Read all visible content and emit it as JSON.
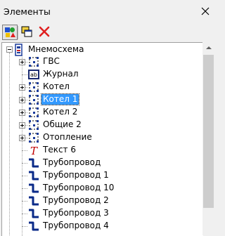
{
  "window": {
    "title": "Элементы"
  },
  "toolbar": {
    "buttons": [
      {
        "name": "elements-view-button",
        "icon": "colored-shapes-icon",
        "pressed": true
      },
      {
        "name": "layers-button",
        "icon": "stacked-windows-icon",
        "pressed": false
      },
      {
        "name": "delete-button",
        "icon": "red-x-icon",
        "pressed": false
      }
    ]
  },
  "tree": {
    "root": {
      "label": "Мнемосхема",
      "icon": "mnemoscheme-icon",
      "expanded": true
    },
    "items": [
      {
        "label": "ГВС",
        "icon": "group-icon",
        "expandable": true
      },
      {
        "label": "Журнал",
        "icon": "journal-icon",
        "expandable": false
      },
      {
        "label": "Котел",
        "icon": "group-icon",
        "expandable": true
      },
      {
        "label": "Котел 1",
        "icon": "group-icon",
        "expandable": true,
        "selected": true
      },
      {
        "label": "Котел 2",
        "icon": "group-icon",
        "expandable": true
      },
      {
        "label": "Общие 2",
        "icon": "group-icon",
        "expandable": true
      },
      {
        "label": "Отопление",
        "icon": "group-icon",
        "expandable": true
      },
      {
        "label": "Текст 6",
        "icon": "text-icon",
        "expandable": false
      },
      {
        "label": "Трубопровод",
        "icon": "pipe-icon",
        "expandable": false
      },
      {
        "label": "Трубопровод 1",
        "icon": "pipe-icon",
        "expandable": false
      },
      {
        "label": "Трубопровод 10",
        "icon": "pipe-icon",
        "expandable": false
      },
      {
        "label": "Трубопровод 2",
        "icon": "pipe-icon",
        "expandable": false
      },
      {
        "label": "Трубопровод 3",
        "icon": "pipe-icon",
        "expandable": false
      },
      {
        "label": "Трубопровод 4",
        "icon": "pipe-icon",
        "expandable": false
      }
    ]
  },
  "colors": {
    "selection": "#3399ff",
    "pipe": "#0a2a88",
    "text_icon": "#c00000",
    "delete": "#e02020"
  }
}
